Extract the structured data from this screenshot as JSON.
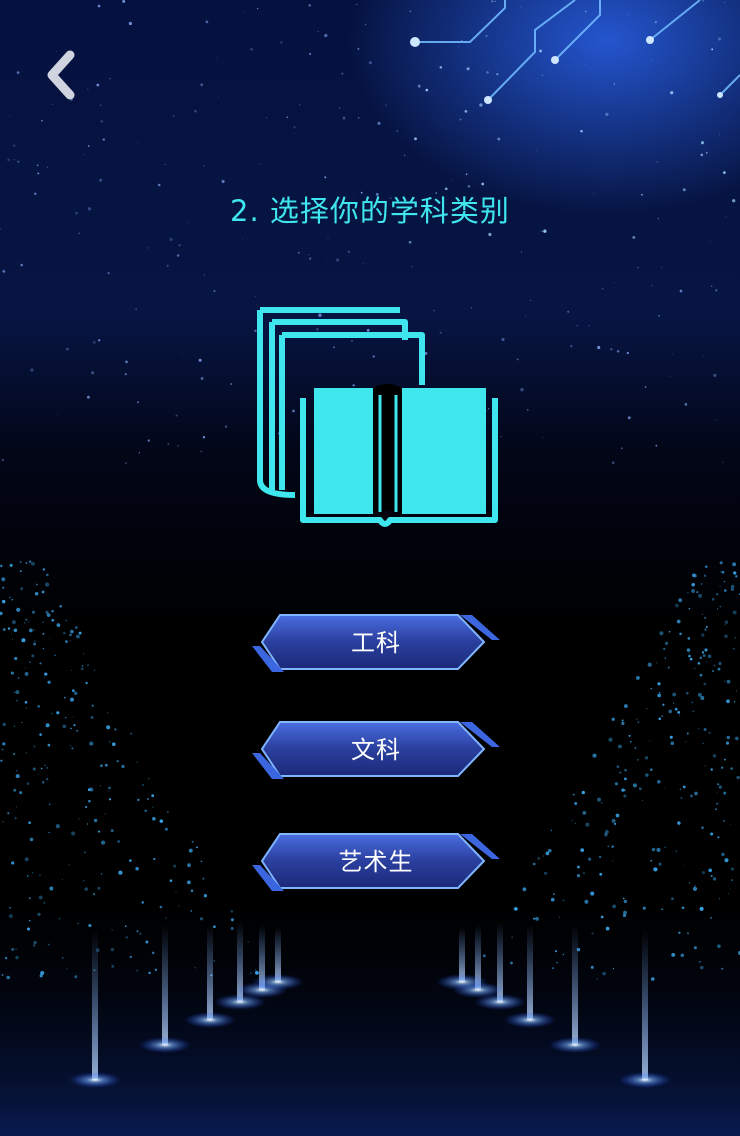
{
  "header": {
    "back_icon": "chevron-left-icon",
    "title": "2. 选择你的学科类别"
  },
  "hero": {
    "icon": "books-icon",
    "color": "#3fe6ee"
  },
  "options": [
    {
      "label": "工科"
    },
    {
      "label": "文科"
    },
    {
      "label": "艺术生"
    }
  ],
  "colors": {
    "accent": "#3fe6ee",
    "button_fill": "#2a3f9e",
    "button_edge": "#5fa8ff",
    "background": "#000000"
  }
}
